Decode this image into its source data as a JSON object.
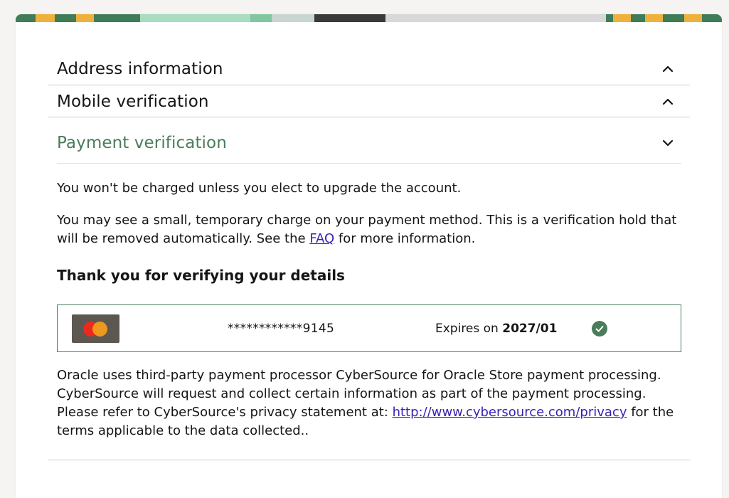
{
  "sections": {
    "address": {
      "title": "Address information"
    },
    "mobile": {
      "title": "Mobile verification"
    },
    "payment": {
      "title": "Payment verification"
    }
  },
  "payment": {
    "no_charge_text": "You won't be charged unless you elect to upgrade the account.",
    "hold_text_before": "You may see a small, temporary charge on your payment method. This is a verification hold that will be removed automatically. See the ",
    "faq_link": "FAQ",
    "hold_text_after": " for more information.",
    "thank_you_heading": "Thank you for verifying your details",
    "card": {
      "brand_icon": "mastercard-icon",
      "masked_number": "************9145",
      "expires_label": "Expires on",
      "expires_value": "2027/01",
      "status_icon": "check-circle-icon"
    },
    "processor_text_before": "Oracle uses third-party payment processor CyberSource for Oracle Store payment processing. CyberSource will request and collect certain information as part of the payment processing. Please refer to CyberSource's privacy statement at: ",
    "privacy_link": "http://www.cybersource.com/privacy",
    "processor_text_after": " for the terms applicable to the data collected.."
  },
  "colors": {
    "accent_green": "#4a7c59",
    "link_purple": "#3c1fb0",
    "mastercard_red": "#eb2a1d",
    "mastercard_yellow": "#f79e1b"
  }
}
